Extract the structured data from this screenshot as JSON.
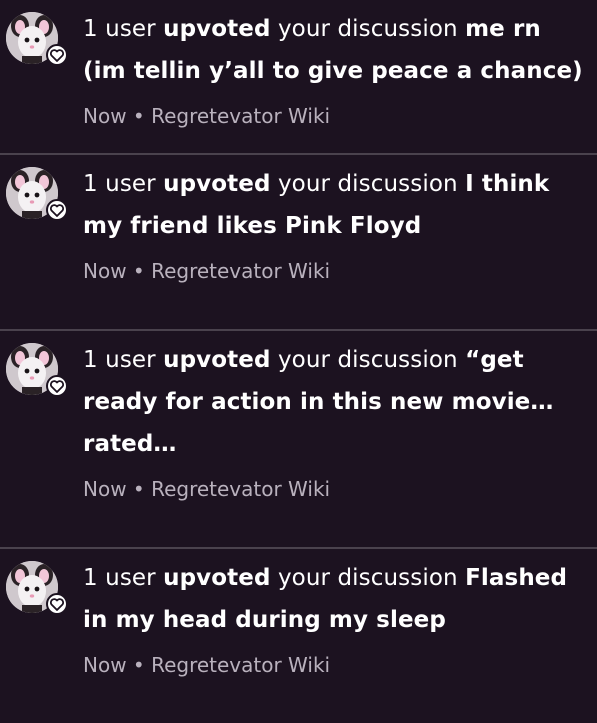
{
  "notifications": [
    {
      "count_text": "1 user",
      "action": "upvoted",
      "middle": "your discussion",
      "title": "me rn (im tellin y’all to give peace a chance)",
      "time": "Now",
      "separator": "•",
      "wiki": "Regretevator Wiki"
    },
    {
      "count_text": "1 user",
      "action": "upvoted",
      "middle": "your discussion",
      "title": "I think my friend likes Pink Floyd",
      "time": "Now",
      "separator": "•",
      "wiki": "Regretevator Wiki"
    },
    {
      "count_text": "1 user",
      "action": "upvoted",
      "middle": "your discussion",
      "title": "“get ready for action in this new movie… rated…",
      "time": "Now",
      "separator": "•",
      "wiki": "Regretevator Wiki"
    },
    {
      "count_text": "1 user",
      "action": "upvoted",
      "middle": "your discussion",
      "title": "Flashed in my head during my sleep",
      "time": "Now",
      "separator": "•",
      "wiki": "Regretevator Wiki"
    }
  ],
  "icons": {
    "avatar": "wiki-avatar-icon",
    "badge": "heart-icon"
  },
  "colors": {
    "background": "#1c1220",
    "divider": "#4a424d",
    "meta_text": "#b9b1bd",
    "text": "#ffffff"
  }
}
